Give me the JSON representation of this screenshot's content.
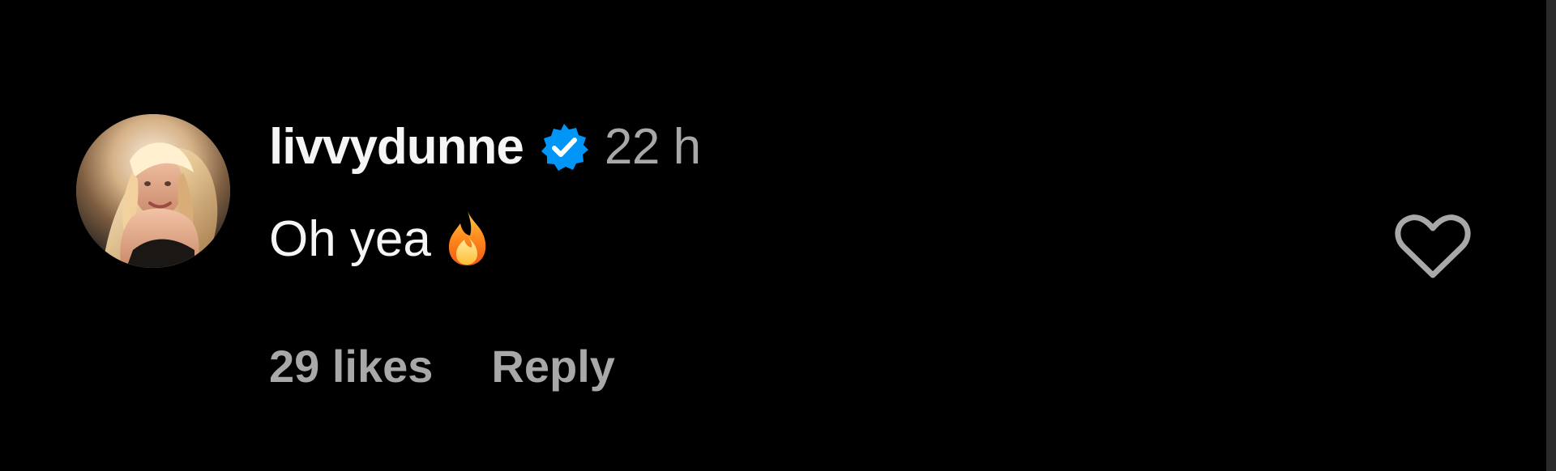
{
  "comment": {
    "username": "livvydunne",
    "verified": true,
    "timestamp": "22 h",
    "text": "Oh yea",
    "emoji": "fire",
    "likes_label": "29 likes",
    "reply_label": "Reply",
    "colors": {
      "background": "#000000",
      "primary_text": "#f5f5f5",
      "secondary_text": "#a8a8a8",
      "verified_badge": "#0095f6",
      "heart_outline": "#a8a8a8"
    },
    "icons": {
      "verified": "verified-badge-icon",
      "reaction": "fire-icon",
      "like": "heart-outline-icon",
      "avatar": "profile-avatar"
    }
  }
}
